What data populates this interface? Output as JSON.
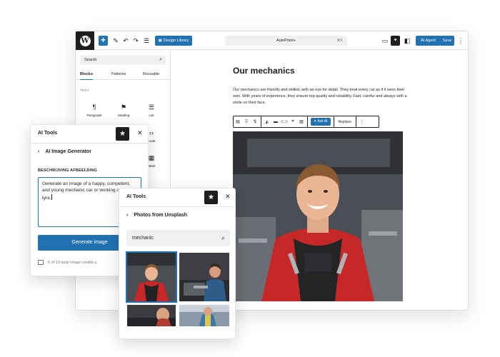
{
  "editor": {
    "logo_letter": "W",
    "toolbar": {
      "add": "+",
      "design_library": "Design Library",
      "document_title": "AutoPoint+",
      "shortcut": "⌘K",
      "ai_agent": "AI Agent",
      "save": "Save",
      "more": "⋮"
    },
    "inserter": {
      "search_placeholder": "Search",
      "tabs": [
        "Blocks",
        "Patterns",
        "Reusable"
      ],
      "category": "TEXT",
      "blocks": [
        {
          "label": "Paragraph",
          "icon": "¶"
        },
        {
          "label": "Heading",
          "icon": "⚑"
        },
        {
          "label": "List",
          "icon": "☰"
        },
        {
          "label": "Code",
          "icon": "‹›"
        },
        {
          "label": "Table",
          "icon": "▦"
        }
      ]
    },
    "page": {
      "heading": "Our mechanics",
      "paragraph": "Our mechanics are friendly and skilled, with an eye for detail. They treat every car as if it were their own. With years of experience, they ensure top quality and reliability. Fast, careful and always with a smile on their face.",
      "block_toolbar": {
        "ask_ai": "Ask AI",
        "replace": "Replace",
        "more": "⋮"
      }
    }
  },
  "image_generator": {
    "title": "AI Tools",
    "subtitle": "AI Image Generator",
    "field_label": "BESCHRIJVING AFBEELDING",
    "prompt_text": "Generate an image of a happy, competent, and young mechanic car or working on a car tyre.",
    "button": "Generate image",
    "credits": "0 of 10 daily image credits u"
  },
  "unsplash": {
    "title": "AI Tools",
    "subtitle": "Photos from Unsplash",
    "search_value": "mechanic"
  },
  "colors": {
    "accent": "#2271b1",
    "dark": "#1e1e1e",
    "overall": "#c62828"
  },
  "icons": {
    "star": "★",
    "close": "×",
    "back": "‹",
    "search": "⌕"
  }
}
